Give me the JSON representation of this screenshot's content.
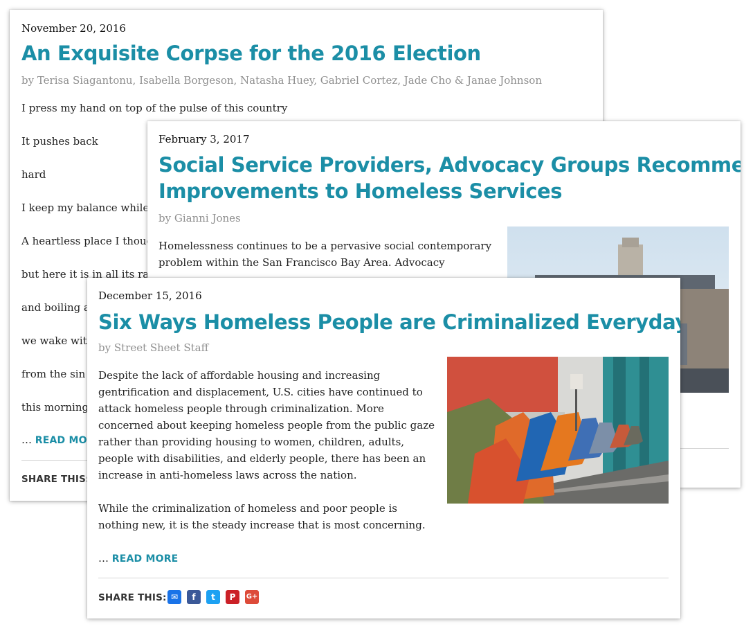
{
  "cards": [
    {
      "date": "November 20, 2016",
      "title": "An Exquisite Corpse for the 2016 Election",
      "byline": "by Terisa Siagantonu, Isabella Borgeson, Natasha Huey, Gabriel Cortez, Jade Cho & Janae Johnson",
      "lines": [
        "I press my hand on top of the pulse of this country",
        "It pushes back",
        "hard",
        "I keep my balance while",
        "A heartless place I thoug",
        "but here it is in all its ra",
        "and boiling a",
        "we wake wit",
        "from the sin",
        "this morning"
      ],
      "ellipsis": "…",
      "read_more": "READ MORE",
      "share_label": "SHARE THIS:"
    },
    {
      "date": "February 3, 2017",
      "title_lines": [
        "Social Service Providers, Advocacy Groups Recommend",
        "Improvements to Homeless Services"
      ],
      "byline": "by Gianni Jones",
      "para_lines": [
        "Homelessness continues to be a pervasive social contemporary",
        "problem within the San Francisco Bay Area. Advocacy"
      ]
    },
    {
      "date": "December 15, 2016",
      "title": "Six Ways Homeless People are Criminalized Everyday",
      "byline": "by Street Sheet Staff",
      "para1": "Despite the lack of affordable housing and increasing gentrification and displacement, U.S. cities have continued to attack homeless people through criminalization. More concerned about keeping homeless people from the public gaze rather than providing housing to women, children,  adults, people with disabilities, and elderly people,  there has been an increase in anti-homeless laws across the nation.",
      "para2": "While the criminalization of homeless and poor people is nothing new, it is the steady increase that is most concerning.",
      "ellipsis": "…",
      "read_more": "READ MORE",
      "share_label": "SHARE THIS:",
      "share_buttons": [
        {
          "icon": "email-icon",
          "glyph": "✉",
          "color": "#1a73e8"
        },
        {
          "icon": "facebook-icon",
          "glyph": "f",
          "color": "#3b5998"
        },
        {
          "icon": "twitter-icon",
          "glyph": "t",
          "color": "#1da1f2"
        },
        {
          "icon": "pinterest-icon",
          "glyph": "P",
          "color": "#cb2027"
        },
        {
          "icon": "google-plus-icon",
          "glyph": "G+",
          "color": "#dd4b39"
        }
      ]
    }
  ],
  "colors": {
    "title": "#1b8ea6",
    "byline": "#8f8f8f",
    "read_more": "#1b8ea6"
  }
}
